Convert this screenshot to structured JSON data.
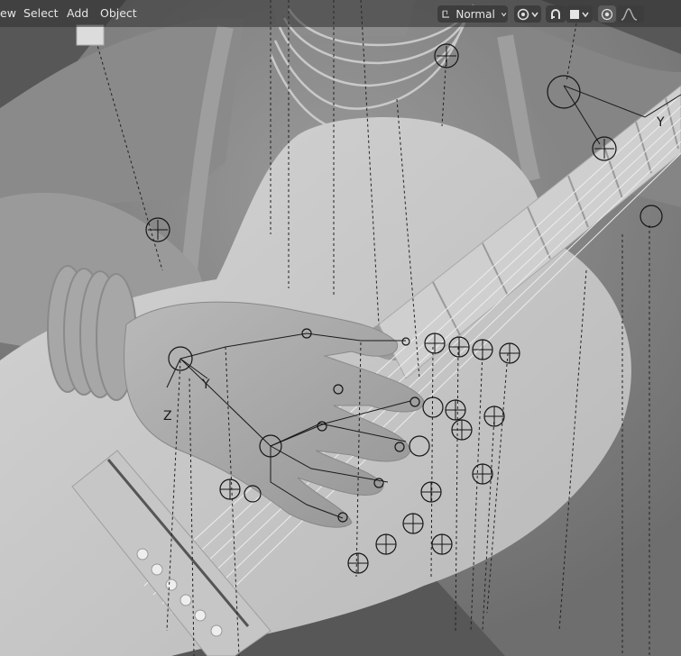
{
  "header": {
    "menus": [
      "ew",
      "Select",
      "Add",
      "Object"
    ],
    "transform_orientation": "Normal",
    "pivot_icon": "pivot-point-icon",
    "snap_icon": "snap-magnet-icon",
    "snap_target_icon": "snap-target-square-icon",
    "proportional_icon": "proportional-edit-icon",
    "falloff_icon": "falloff-curve-icon"
  },
  "viewport": {
    "axis_labels": [
      "Y",
      "Z",
      "Y"
    ],
    "bg_color": "#5a5a5a"
  }
}
